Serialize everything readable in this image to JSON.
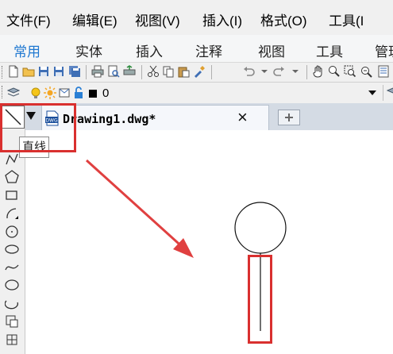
{
  "menu": [
    "文件(F)",
    "编辑(E)",
    "视图(V)",
    "插入(I)",
    "格式(O)",
    "工具(I"
  ],
  "ribbon_tabs": [
    "常用",
    "实体",
    "插入",
    "注释",
    "视图",
    "工具",
    "管理"
  ],
  "active_ribbon_tab": "常用",
  "layer_value": "0",
  "document_tab": {
    "name": "Drawing1.dwg*",
    "close_glyph": "×"
  },
  "tooltip": "直线",
  "colors": {
    "accent": "#1f78d1",
    "highlight": "#d9302f"
  },
  "side_tools": [
    "line-icon",
    "polyline-icon",
    "polygon-icon",
    "rectangle-icon",
    "arc-icon",
    "circle-icon",
    "revision-cloud-icon",
    "spline-icon",
    "ellipse-icon",
    "ellipse-arc-icon",
    "insert-block-icon",
    "make-block-icon"
  ]
}
